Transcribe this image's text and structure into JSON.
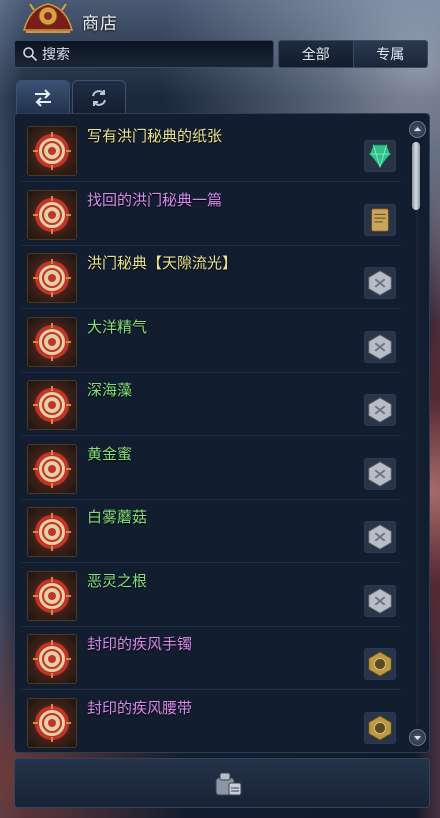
{
  "window": {
    "title": "商店"
  },
  "search": {
    "placeholder": "搜索",
    "value": ""
  },
  "filters": [
    {
      "label": "全部",
      "active": true
    },
    {
      "label": "专属",
      "active": false
    }
  ],
  "tabs": [
    {
      "icon": "swap-arrows-icon",
      "active": true
    },
    {
      "icon": "refresh-icon",
      "active": false
    }
  ],
  "items": [
    {
      "name": "写有洪门秘典的纸张",
      "color": "#e7e38f",
      "cost_icon": "green-crystal-icon"
    },
    {
      "name": "找回的洪门秘典一篇",
      "color": "#d58be9",
      "cost_icon": "scroll-book-icon"
    },
    {
      "name": "洪门秘典【天隙流光】",
      "color": "#e7e38f",
      "cost_icon": "silver-coin-icon"
    },
    {
      "name": "大洋精气",
      "color": "#86e07a",
      "cost_icon": "silver-coin-icon"
    },
    {
      "name": "深海藻",
      "color": "#86e07a",
      "cost_icon": "silver-coin-icon"
    },
    {
      "name": "黄金蜜",
      "color": "#86e07a",
      "cost_icon": "silver-coin-icon"
    },
    {
      "name": "白雾蘑菇",
      "color": "#86e07a",
      "cost_icon": "silver-coin-icon"
    },
    {
      "name": "恶灵之根",
      "color": "#86e07a",
      "cost_icon": "silver-coin-icon"
    },
    {
      "name": "封印的疾风手镯",
      "color": "#d58be9",
      "cost_icon": "gold-medal-icon"
    },
    {
      "name": "封印的疾风腰带",
      "color": "#d58be9",
      "cost_icon": "gold-medal-icon"
    }
  ],
  "bottom": {
    "button_icon": "purchase-bag-icon"
  }
}
